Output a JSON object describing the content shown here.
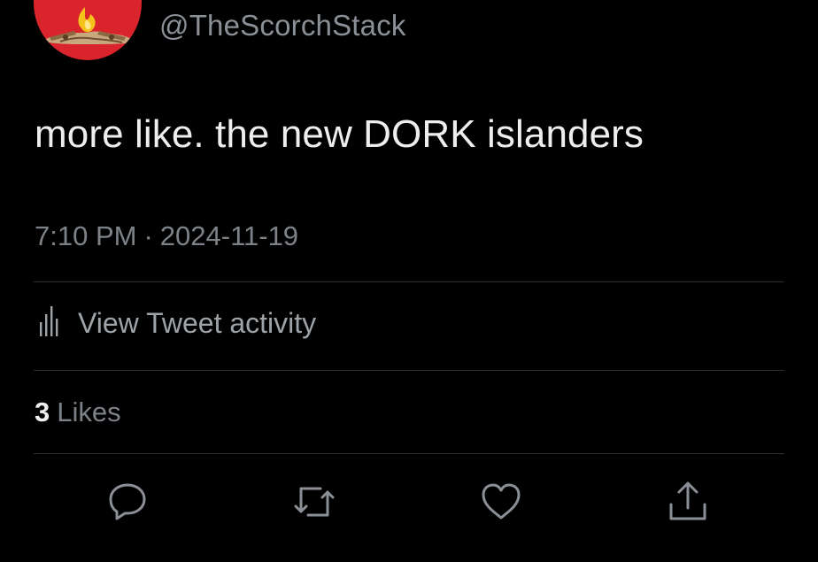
{
  "tweet": {
    "avatar_icon": "bonfire-logo-avatar",
    "avatar_color": "#d8242a",
    "handle": "@TheScorchStack",
    "text": "more like. the new DORK islanders",
    "time": "7:10 PM",
    "separator": "·",
    "date": "2024-11-19"
  },
  "activity": {
    "icon": "bar-chart-icon",
    "label": "View Tweet activity"
  },
  "likes": {
    "count": "3",
    "label": "Likes"
  },
  "actions": [
    {
      "icon": "reply-icon"
    },
    {
      "icon": "retweet-icon"
    },
    {
      "icon": "like-icon"
    },
    {
      "icon": "share-icon"
    }
  ],
  "colors": {
    "background": "#000000",
    "primary_text": "#eceef0",
    "secondary_text": "#7d8288",
    "divider": "#2b2e31",
    "icon": "#8b9096"
  }
}
